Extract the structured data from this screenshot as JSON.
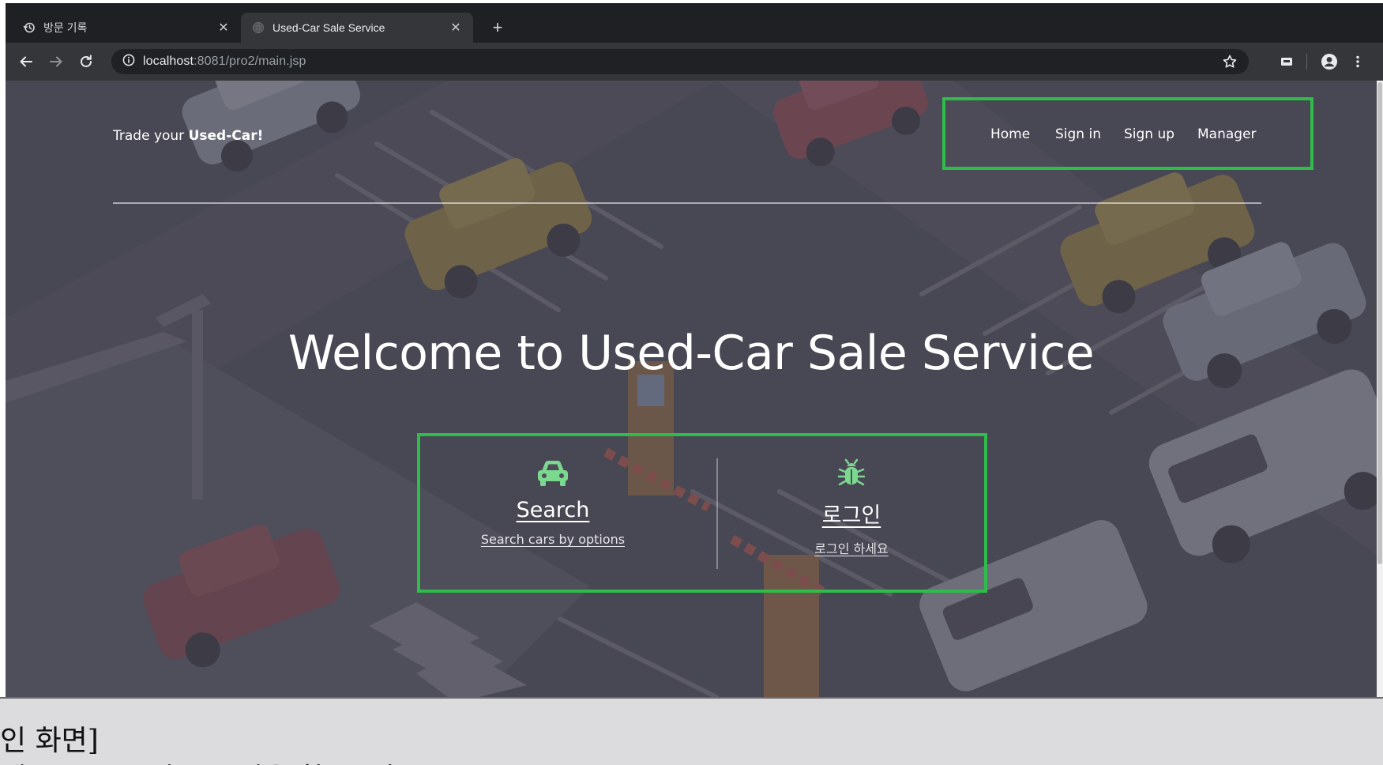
{
  "browser": {
    "tabs": [
      {
        "title": "방문 기록",
        "icon": "history-icon",
        "active": false
      },
      {
        "title": "Used-Car Sale Service",
        "icon": "globe-icon",
        "active": true
      }
    ],
    "address": {
      "host": "localhost",
      "rest": ":8081/pro2/main.jsp"
    }
  },
  "site": {
    "brand_prefix": "Trade your ",
    "brand_strong": "Used-Car!",
    "nav": [
      "Home",
      "Sign in",
      "Sign up",
      "Manager"
    ],
    "hero_title": "Welcome to Used-Car Sale Service",
    "actions": [
      {
        "icon": "car-icon",
        "title": "Search",
        "subtitle": "Search cars by options"
      },
      {
        "icon": "bug-icon",
        "title": "로그인",
        "subtitle": "로그인 하세요"
      }
    ]
  },
  "caption": {
    "line1": "인 화면]",
    "line2": "세(Search)과 로그인을 할 수 있음"
  },
  "colors": {
    "highlight": "#2ebc4a",
    "icon_green": "#7bd88f"
  }
}
